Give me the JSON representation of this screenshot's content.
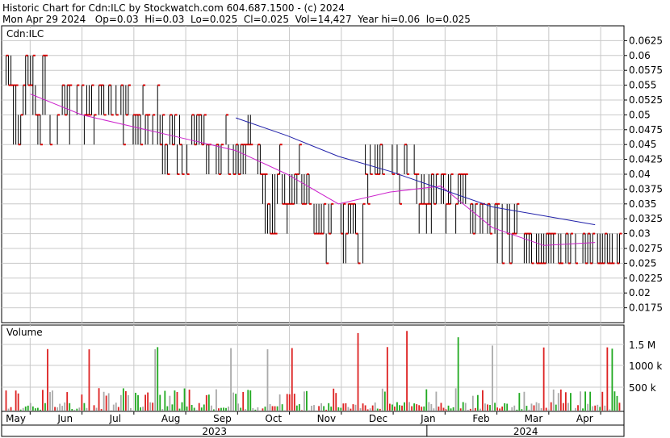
{
  "header": {
    "line1": "Historic Chart for Cdn:ILC by Stockwatch.com 604.687.1500 - (c) 2024",
    "line2": "Mon Apr 29 2024   Op=0.03  Hi=0.03  Lo=0.025  Cl=0.025  Vol=14,427  Year hi=0.06  lo=0.025"
  },
  "chart_data": {
    "type": "ohlc-bar",
    "symbol": "Cdn:ILC",
    "price_axis": {
      "min": 0.015,
      "max": 0.065,
      "ticks": [
        "0.0625",
        "0.06",
        "0.0575",
        "0.055",
        "0.0525",
        "0.05",
        "0.0475",
        "0.045",
        "0.0425",
        "0.04",
        "0.0375",
        "0.035",
        "0.0325",
        "0.03",
        "0.0275",
        "0.025",
        "0.0225",
        "0.02",
        "0.0175"
      ]
    },
    "volume_panel": {
      "label": "Volume",
      "ticks": [
        "1.5 M",
        "1000 k",
        "500 k"
      ],
      "colors": {
        "up": "#22aa22",
        "down": "#dd2222",
        "flat": "#aaaaaa"
      }
    },
    "x_axis": {
      "months": [
        "May",
        "Jun",
        "Jul",
        "Aug",
        "Sep",
        "Oct",
        "Nov",
        "Dec",
        "Jan",
        "Feb",
        "Mar",
        "Apr"
      ],
      "years": [
        "2023",
        "2024"
      ]
    },
    "price_series": [
      {
        "period": "May 2023",
        "range": [
          0.045,
          0.06
        ],
        "typical_close": 0.055
      },
      {
        "period": "Jun 2023",
        "range": [
          0.045,
          0.055
        ],
        "typical_close": 0.05
      },
      {
        "period": "Jul 2023",
        "range": [
          0.045,
          0.055
        ],
        "typical_close": 0.045
      },
      {
        "period": "Aug 2023",
        "range": [
          0.04,
          0.05
        ],
        "typical_close": 0.045
      },
      {
        "period": "Sep 2023",
        "range": [
          0.04,
          0.05
        ],
        "typical_close": 0.04
      },
      {
        "period": "Oct 2023",
        "range": [
          0.03,
          0.045
        ],
        "typical_close": 0.035
      },
      {
        "period": "Nov 2023",
        "range": [
          0.025,
          0.035
        ],
        "typical_close": 0.03
      },
      {
        "period": "Dec 2023",
        "range": [
          0.035,
          0.045
        ],
        "typical_close": 0.04
      },
      {
        "period": "Jan 2024",
        "range": [
          0.03,
          0.04
        ],
        "typical_close": 0.035
      },
      {
        "period": "Feb 2024",
        "range": [
          0.025,
          0.035
        ],
        "typical_close": 0.03
      },
      {
        "period": "Mar 2024",
        "range": [
          0.025,
          0.03
        ],
        "typical_close": 0.025
      },
      {
        "period": "Apr 2024",
        "range": [
          0.025,
          0.03
        ],
        "typical_close": 0.025
      }
    ],
    "moving_averages": [
      {
        "color": "#cc22cc",
        "values": [
          0.0535,
          0.05,
          0.048,
          0.046,
          0.044,
          0.04,
          0.035,
          0.037,
          0.038,
          0.031,
          0.028,
          0.0285
        ]
      },
      {
        "color": "#2222aa",
        "values": [
          null,
          null,
          null,
          null,
          0.0495,
          0.0465,
          0.043,
          0.0405,
          0.0375,
          0.0345,
          0.033,
          0.0315
        ]
      }
    ],
    "grid": true,
    "colors": {
      "down_tick": "#dd0000",
      "bar": "#000000"
    }
  }
}
